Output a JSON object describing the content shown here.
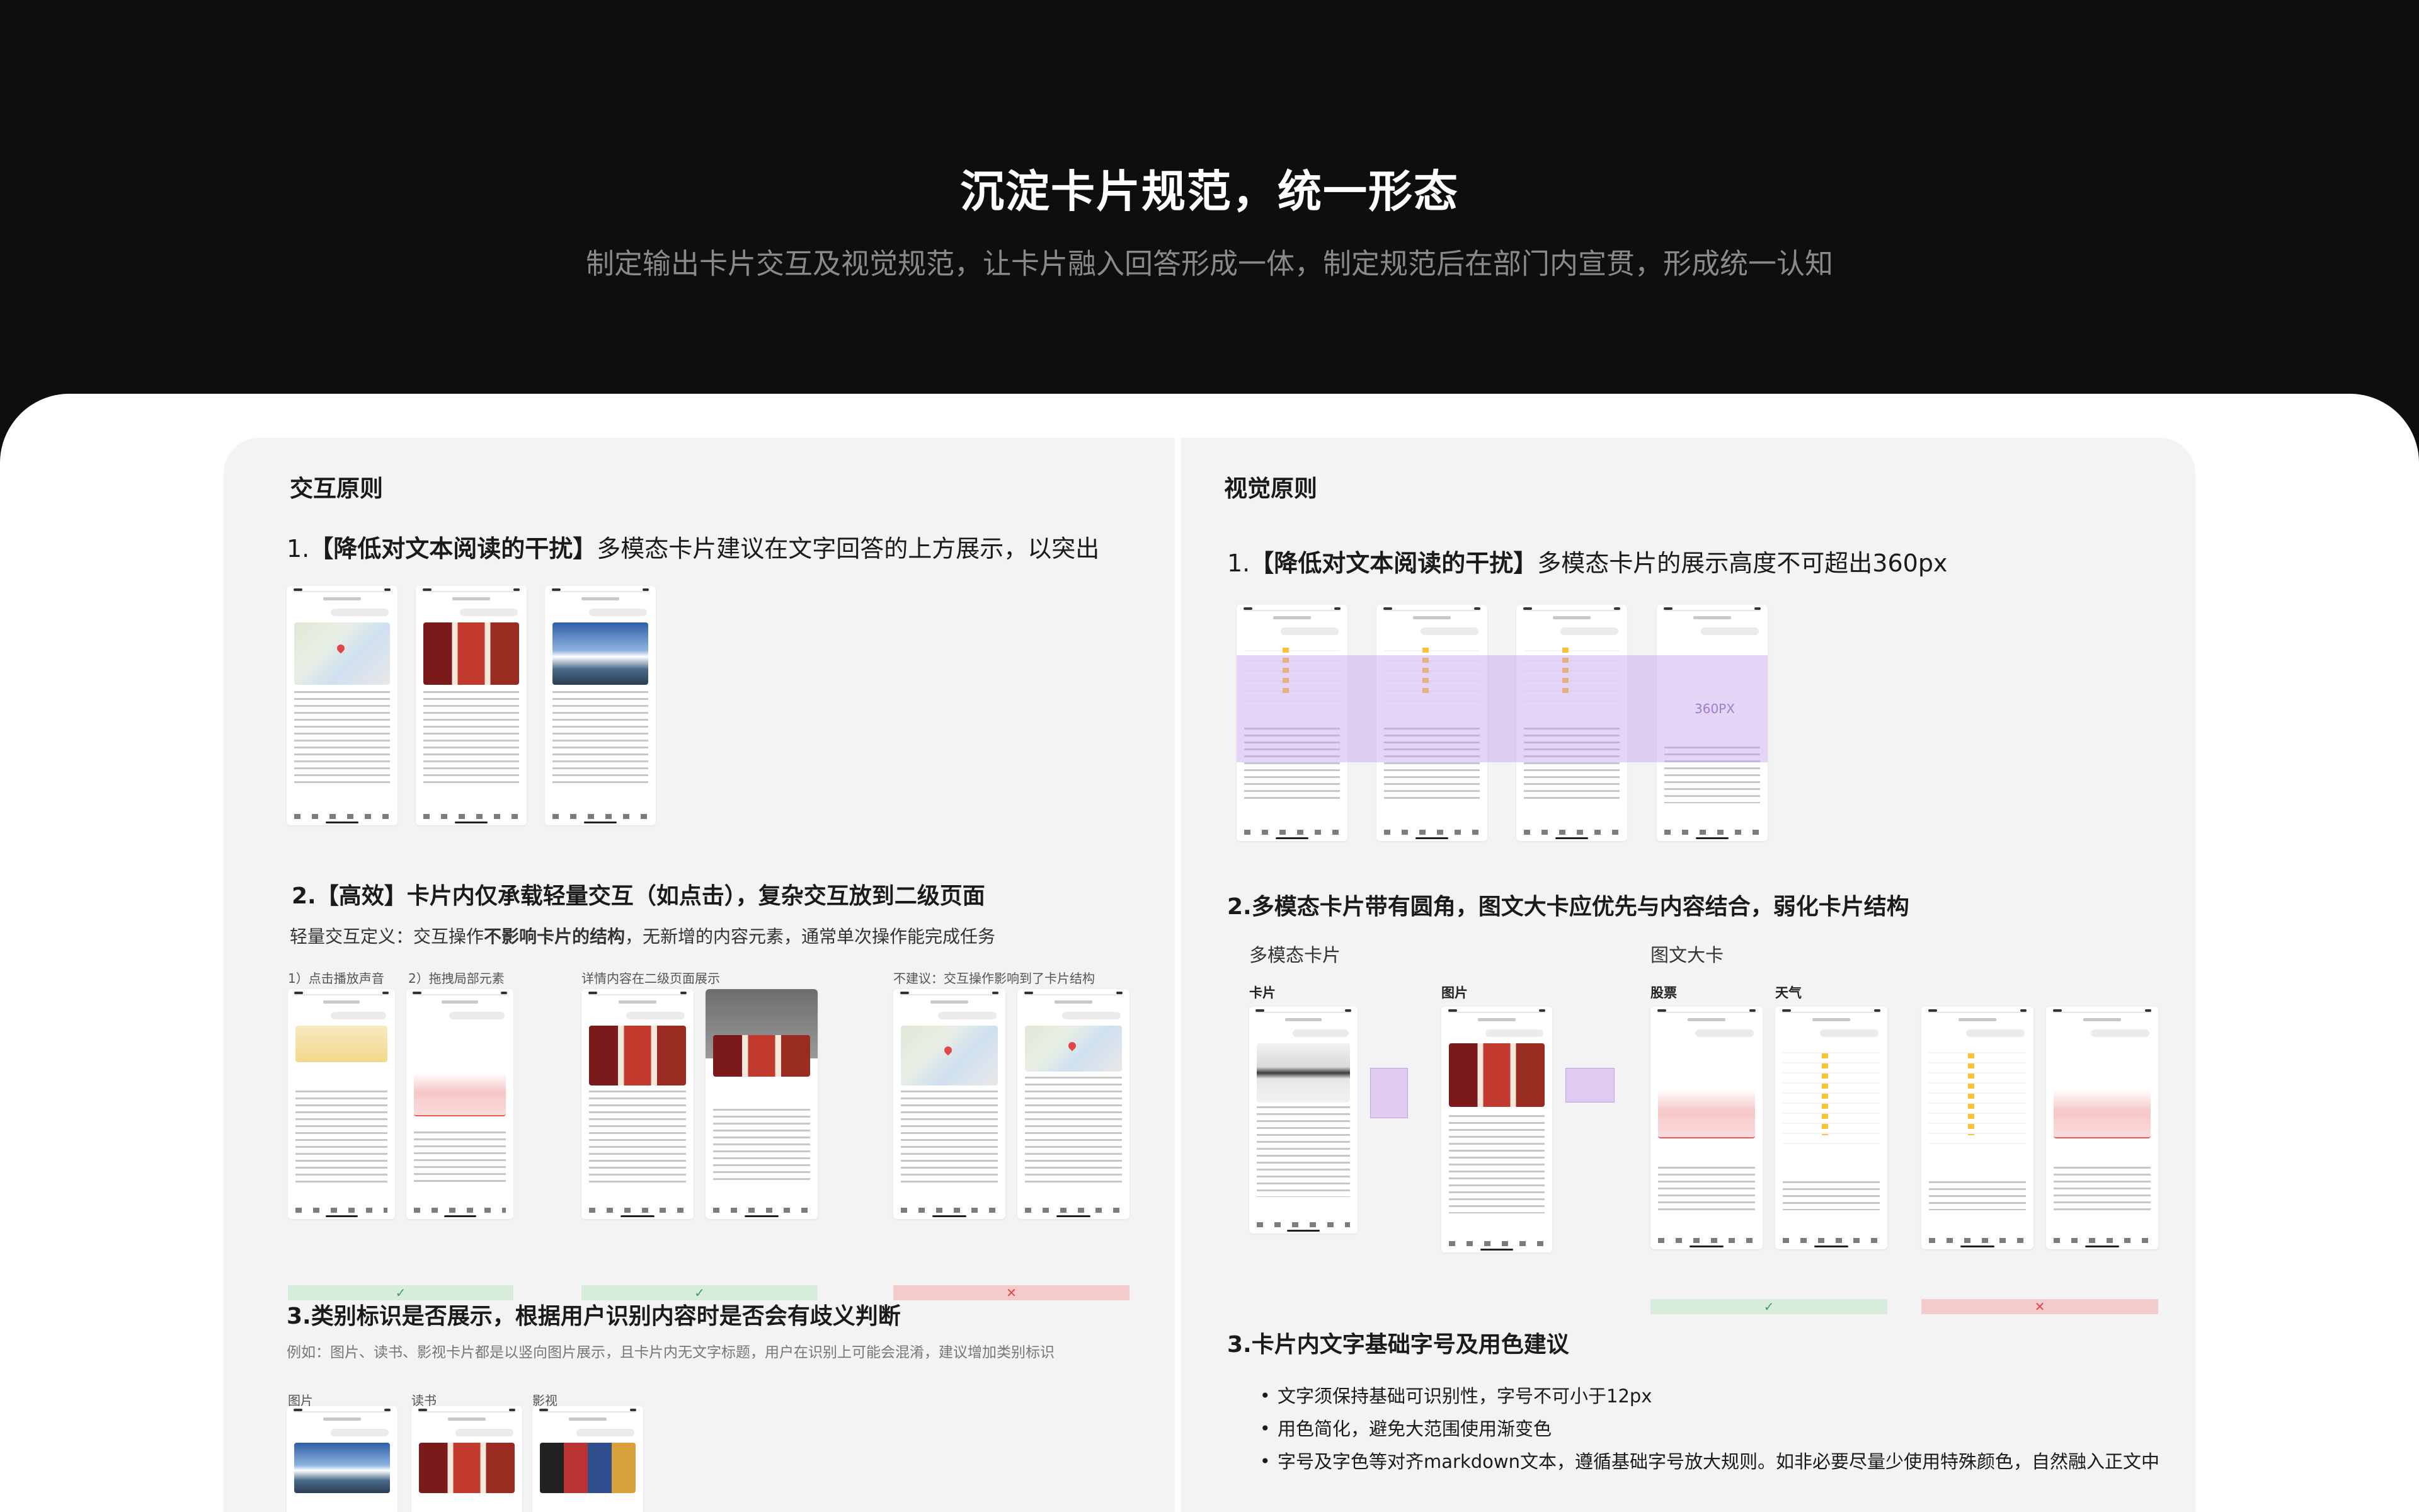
{
  "hero": {
    "title": "沉淀卡片规范，统一形态",
    "subtitle": "制定输出卡片交互及视觉规范，让卡片融入回答形成一体，制定规范后在部门内宣贯，形成统一认知"
  },
  "interaction": {
    "section_title": "交互原则",
    "rule1": {
      "num": "1.",
      "bold": "【降低对文本阅读的干扰】",
      "text": "多模态卡片建议在文字回答的上方展示，以突出"
    },
    "rule2": {
      "num": "2.",
      "bold": "【高效】卡片内仅承载轻量交互（如点击），复杂交互放到二级页面",
      "def_prefix": "轻量交互定义：交互操作",
      "def_bold": "不影响卡片的结构",
      "def_suffix": "，无新增的内容元素，通常单次操作能完成任务",
      "labels": [
        "1）点击播放声音",
        "2）拖拽局部元素",
        "详情内容在二级页面展示",
        "不建议：交互操作影响到了卡片结构"
      ],
      "marks": [
        "✓",
        "✓",
        "✕"
      ]
    },
    "rule3": {
      "title": "3.类别标识是否展示，根据用户识别内容时是否会有歧义判断",
      "note": "例如：图片、读书、影视卡片都是以竖向图片展示，且卡片内无文字标题，用户在识别上可能会混淆，建议增加类别标识",
      "labels": [
        "图片",
        "读书",
        "影视"
      ]
    }
  },
  "visual": {
    "section_title": "视觉原则",
    "rule1": {
      "num": "1.",
      "bold": "【降低对文本阅读的干扰】",
      "text": "多模态卡片的展示高度不可超出360px",
      "height_tag": "360PX"
    },
    "rule2": {
      "title": "2.多模态卡片带有圆角，图文大卡应优先与内容结合，弱化卡片结构",
      "group1": "多模态卡片",
      "group2": "图文大卡",
      "labels": [
        "卡片",
        "图片",
        "股票",
        "天气"
      ],
      "marks": [
        "✓",
        "✕"
      ]
    },
    "rule3": {
      "title": "3.卡片内文字基础字号及用色建议",
      "bullets": [
        "文字须保持基础可识别性，字号不可小于12px",
        "用色简化，避免大范围使用渐变色",
        "字号及字色等对齐markdown文本，遵循基础字号放大规则。如非必要尽量少使用特殊颜色，自然融入正文中"
      ]
    }
  },
  "colors": {
    "background": "#0e0e0e",
    "sheet": "#ffffff",
    "card": "#f3f3f4",
    "ok": "#3aa35b",
    "bad": "#e04848",
    "highlight": "#c4a0e8"
  }
}
